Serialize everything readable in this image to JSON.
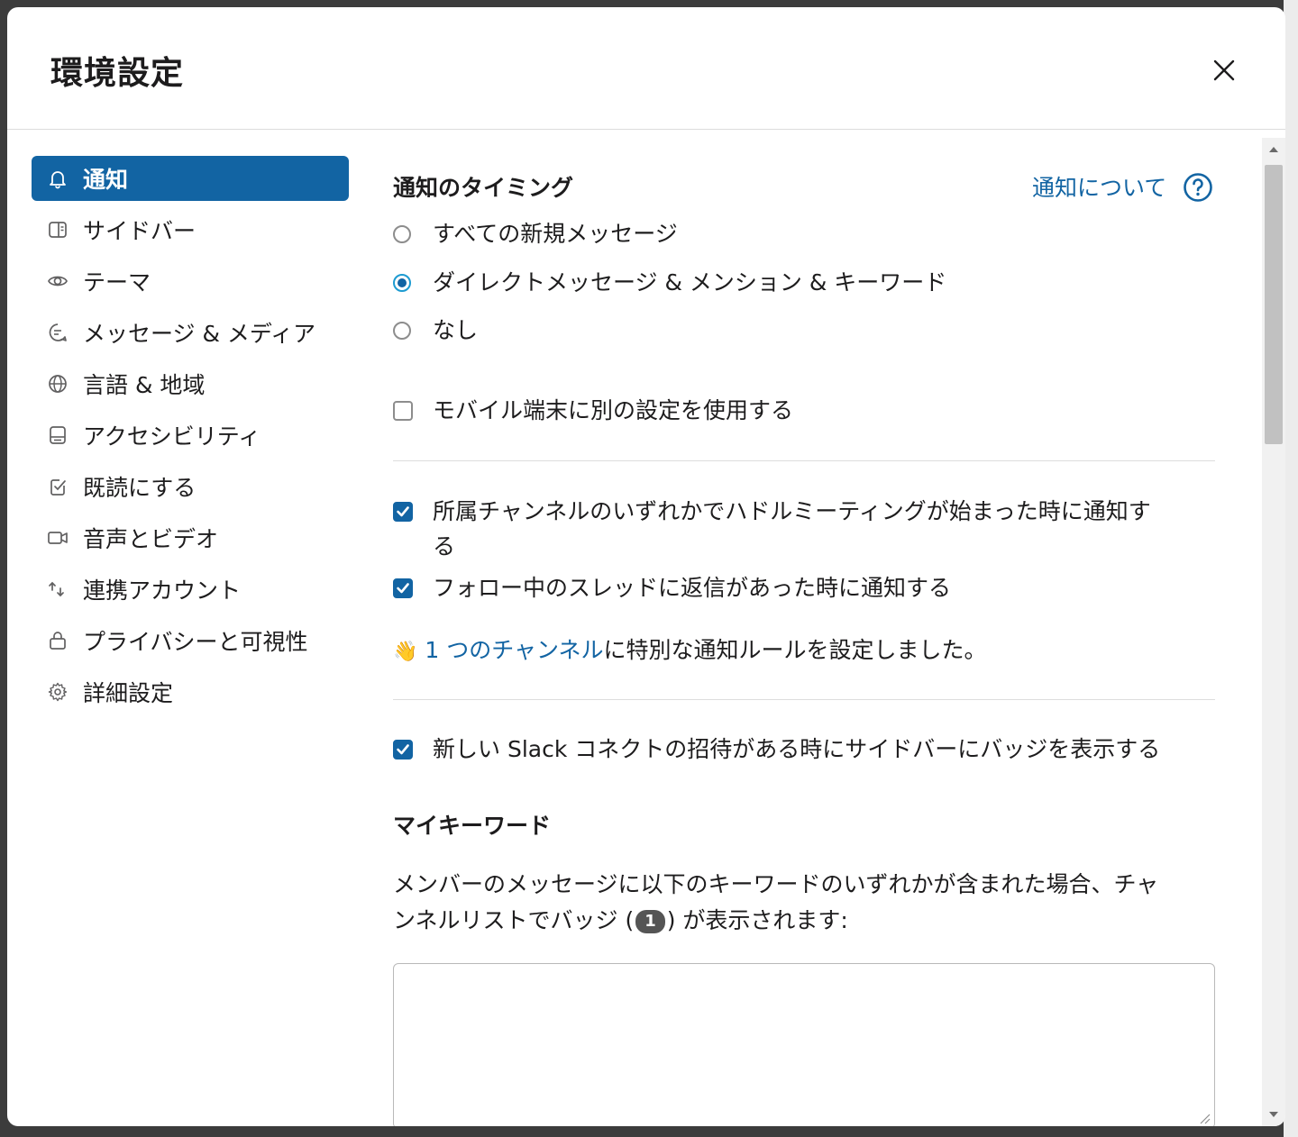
{
  "dialog": {
    "title": "環境設定",
    "close_icon": "close-icon"
  },
  "sidebar": {
    "items": [
      {
        "label": "通知",
        "icon": "bell-icon",
        "active": true
      },
      {
        "label": "サイドバー",
        "icon": "sidebar-icon"
      },
      {
        "label": "テーマ",
        "icon": "eye-icon"
      },
      {
        "label": "メッセージ & メディア",
        "icon": "message-icon"
      },
      {
        "label": "言語 & 地域",
        "icon": "globe-icon"
      },
      {
        "label": "アクセシビリティ",
        "icon": "accessibility-icon"
      },
      {
        "label": "既読にする",
        "icon": "check-square-icon"
      },
      {
        "label": "音声とビデオ",
        "icon": "video-icon"
      },
      {
        "label": "連携アカウント",
        "icon": "connected-accounts-icon"
      },
      {
        "label": "プライバシーと可視性",
        "icon": "lock-icon"
      },
      {
        "label": "詳細設定",
        "icon": "gear-icon"
      }
    ]
  },
  "notifications": {
    "timing_title": "通知のタイミング",
    "help_link": "通知について",
    "radio_options": [
      {
        "label": "すべての新規メッセージ",
        "checked": false
      },
      {
        "label": "ダイレクトメッセージ & メンション & キーワード",
        "checked": true
      },
      {
        "label": "なし",
        "checked": false
      }
    ],
    "mobile_checkbox": {
      "label": "モバイル端末に別の設定を使用する",
      "checked": false
    },
    "huddle_checkbox": {
      "label_line1": "所属チャンネルのいずれかでハドルミーティングが始まった時に通知す",
      "label_line2": "る",
      "checked": true
    },
    "thread_checkbox": {
      "label": "フォロー中のスレッドに返信があった時に通知する",
      "checked": true
    },
    "channel_rule": {
      "emoji": "👋",
      "link": "1 つのチャンネル",
      "text": "に特別な通知ルールを設定しました。"
    },
    "slack_connect_checkbox": {
      "label": "新しい Slack コネクトの招待がある時にサイドバーにバッジを表示する",
      "checked": true
    },
    "keywords_title": "マイキーワード",
    "keywords_desc_line1": "メンバーのメッセージに以下のキーワードのいずれかが含まれた場合、チャ",
    "keywords_desc_line2_before": "ンネルリストでバッジ (",
    "keywords_badge": "1",
    "keywords_desc_line2_after": ") が表示されます:",
    "keywords_value": ""
  },
  "colors": {
    "accent": "#1264a3",
    "header_border": "#dddddd",
    "text": "#1d1c1d"
  }
}
